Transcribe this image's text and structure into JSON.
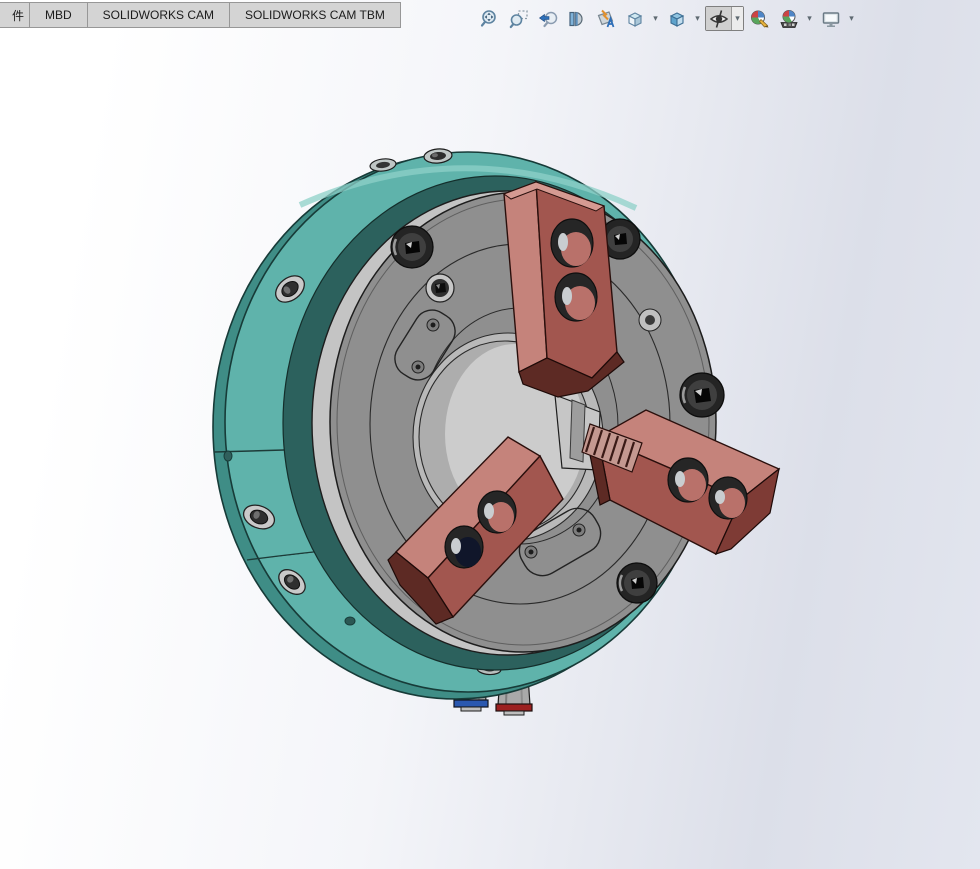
{
  "command_tabs": {
    "items": [
      {
        "label": "件"
      },
      {
        "label": "MBD"
      },
      {
        "label": "SOLIDWORKS CAM"
      },
      {
        "label": "SOLIDWORKS CAM TBM"
      }
    ]
  },
  "view_toolbar": {
    "dropdown_glyph": "▾",
    "buttons": [
      {
        "name": "zoom-to-fit"
      },
      {
        "name": "zoom-to-area"
      },
      {
        "name": "previous-view"
      },
      {
        "name": "section-view"
      },
      {
        "name": "dynamic-annotation-views"
      },
      {
        "name": "view-orientation",
        "has_dropdown": true
      },
      {
        "name": "display-style",
        "has_dropdown": true
      },
      {
        "name": "hide-show-items",
        "has_dropdown": true,
        "pressed": true
      },
      {
        "name": "edit-appearance"
      },
      {
        "name": "apply-scene",
        "has_dropdown": true
      },
      {
        "name": "view-settings",
        "has_dropdown": true
      }
    ]
  },
  "viewport": {
    "background": {
      "left": "#ffffff",
      "right": "#dcdfe9"
    },
    "model": {
      "colors": {
        "outline": "#1d1d1d",
        "teal_side": "#3f8d86",
        "teal_face": "#5fb3ab",
        "teal_highlight": "#8ed0c8",
        "teal_inner": "#2c615d",
        "ring_silver": "#c4c4c4",
        "face_gray": "#8f8f8f",
        "bore_rim": "#b9b9b9",
        "bore_light": "#cccccc",
        "slide_light": "#c6c6c6",
        "jaw_top": "#c5837b",
        "jaw_front": "#a2564f",
        "jaw_side": "#7e3b35",
        "jaw_dark": "#5d2a24",
        "hole_red": "#b9716a",
        "hole_navy": "#10162a",
        "screw_dark": "#242424",
        "screw_mid": "#3f3f3f",
        "silver_ring": "#c9c9c9",
        "fitting_gray": "#a9a9a9",
        "fitting_blue": "#2a58b0",
        "fitting_red": "#9c2020"
      }
    }
  }
}
